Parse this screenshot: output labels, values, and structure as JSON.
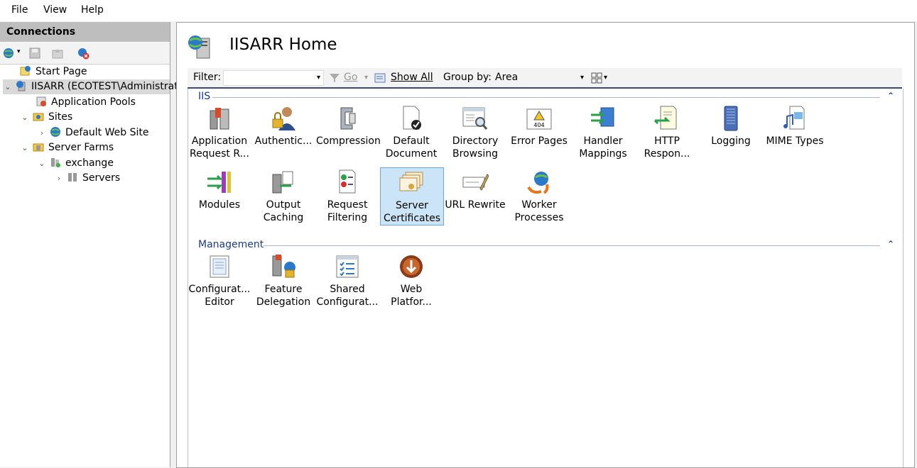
{
  "menu": {
    "file": "File",
    "view": "View",
    "help": "Help"
  },
  "connections": {
    "title": "Connections",
    "tree": {
      "start_page": "Start Page",
      "server": "IISARR (ECOTEST\\Administrat",
      "app_pools": "Application Pools",
      "sites": "Sites",
      "default_web_site": "Default Web Site",
      "server_farms": "Server Farms",
      "exchange": "exchange",
      "servers": "Servers"
    }
  },
  "home": {
    "title": "IISARR Home"
  },
  "filterbar": {
    "filter_label": "Filter:",
    "go": "Go",
    "show_all": "Show All",
    "group_by_label": "Group by:",
    "group_by_value": "Area"
  },
  "groups": {
    "iis": {
      "label": "IIS",
      "features": [
        {
          "l1": "Application",
          "l2": "Request R..."
        },
        {
          "l1": "Authentic...",
          "l2": ""
        },
        {
          "l1": "Compression",
          "l2": ""
        },
        {
          "l1": "Default",
          "l2": "Document"
        },
        {
          "l1": "Directory",
          "l2": "Browsing"
        },
        {
          "l1": "Error Pages",
          "l2": ""
        },
        {
          "l1": "Handler",
          "l2": "Mappings"
        },
        {
          "l1": "HTTP",
          "l2": "Respon..."
        },
        {
          "l1": "Logging",
          "l2": ""
        },
        {
          "l1": "MIME Types",
          "l2": ""
        },
        {
          "l1": "Modules",
          "l2": ""
        },
        {
          "l1": "Output",
          "l2": "Caching"
        },
        {
          "l1": "Request",
          "l2": "Filtering"
        },
        {
          "l1": "Server",
          "l2": "Certificates"
        },
        {
          "l1": "URL Rewrite",
          "l2": ""
        },
        {
          "l1": "Worker",
          "l2": "Processes"
        }
      ]
    },
    "management": {
      "label": "Management",
      "features": [
        {
          "l1": "Configurat...",
          "l2": "Editor"
        },
        {
          "l1": "Feature",
          "l2": "Delegation"
        },
        {
          "l1": "Shared",
          "l2": "Configurat..."
        },
        {
          "l1": "Web",
          "l2": "Platfor..."
        }
      ]
    }
  }
}
